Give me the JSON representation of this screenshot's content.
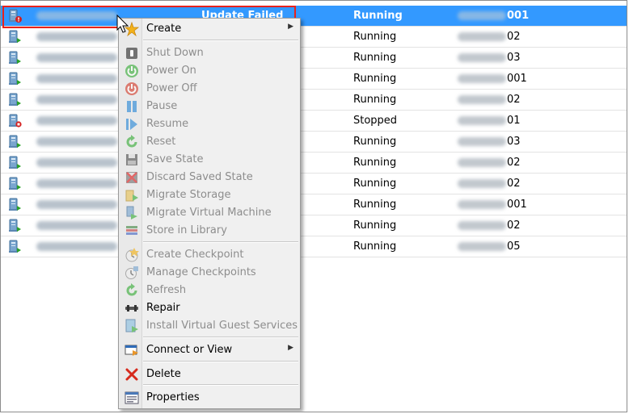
{
  "rows": [
    {
      "status": "Update Failed",
      "state": "Running",
      "host_suffix": "001",
      "selected": true,
      "icon": "vm-error-icon"
    },
    {
      "status": "",
      "state": "Running",
      "host_suffix": "02",
      "icon": "vm-running-icon"
    },
    {
      "status": "",
      "state": "Running",
      "host_suffix": "03",
      "icon": "vm-running-icon"
    },
    {
      "status": "",
      "state": "Running",
      "host_suffix": "001",
      "icon": "vm-running-icon"
    },
    {
      "status": "",
      "state": "Running",
      "host_suffix": "02",
      "icon": "vm-running-icon"
    },
    {
      "status": "",
      "state": "Stopped",
      "host_suffix": "01",
      "icon": "vm-stopped-icon"
    },
    {
      "status": "",
      "state": "Running",
      "host_suffix": "03",
      "icon": "vm-running-icon"
    },
    {
      "status": "",
      "state": "Running",
      "host_suffix": "02",
      "icon": "vm-running-icon"
    },
    {
      "status": "",
      "state": "Running",
      "host_suffix": "02",
      "icon": "vm-running-icon"
    },
    {
      "status": "",
      "state": "Running",
      "host_suffix": "001",
      "icon": "vm-running-icon"
    },
    {
      "status": "",
      "state": "Running",
      "host_suffix": "02",
      "icon": "vm-running-icon"
    },
    {
      "status": "",
      "state": "Running",
      "host_suffix": "05",
      "icon": "vm-running-icon"
    }
  ],
  "context_menu": {
    "items": [
      {
        "label": "Create",
        "icon": "create-star-icon",
        "enabled": true,
        "submenu": true
      },
      {
        "label": "Shut Down",
        "icon": "shutdown-icon",
        "enabled": false
      },
      {
        "label": "Power On",
        "icon": "power-on-icon",
        "enabled": false
      },
      {
        "label": "Power Off",
        "icon": "power-off-icon",
        "enabled": false
      },
      {
        "label": "Pause",
        "icon": "pause-icon",
        "enabled": false
      },
      {
        "label": "Resume",
        "icon": "resume-icon",
        "enabled": false
      },
      {
        "label": "Reset",
        "icon": "reset-icon",
        "enabled": false
      },
      {
        "label": "Save State",
        "icon": "save-state-icon",
        "enabled": false
      },
      {
        "label": "Discard Saved State",
        "icon": "discard-saved-state-icon",
        "enabled": false
      },
      {
        "label": "Migrate Storage",
        "icon": "migrate-storage-icon",
        "enabled": false
      },
      {
        "label": "Migrate Virtual Machine",
        "icon": "migrate-vm-icon",
        "enabled": false
      },
      {
        "label": "Store in Library",
        "icon": "library-icon",
        "enabled": false
      },
      {
        "label": "Create Checkpoint",
        "icon": "create-checkpoint-icon",
        "enabled": false
      },
      {
        "label": "Manage Checkpoints",
        "icon": "manage-checkpoints-icon",
        "enabled": false
      },
      {
        "label": "Refresh",
        "icon": "refresh-icon",
        "enabled": false
      },
      {
        "label": "Repair",
        "icon": "repair-icon",
        "enabled": true
      },
      {
        "label": "Install Virtual Guest Services",
        "icon": "install-guest-services-icon",
        "enabled": false
      },
      {
        "label": "Connect or View",
        "icon": "connect-view-icon",
        "enabled": true,
        "submenu": true
      },
      {
        "label": "Delete",
        "icon": "delete-x-icon",
        "enabled": true
      },
      {
        "label": "Properties",
        "icon": "properties-icon",
        "enabled": true
      }
    ]
  },
  "colors": {
    "selection": "#3399ff",
    "highlight_outline": "#e8221b",
    "menu_bg": "#f0f0f0",
    "disabled_text": "#8d8d8d"
  }
}
